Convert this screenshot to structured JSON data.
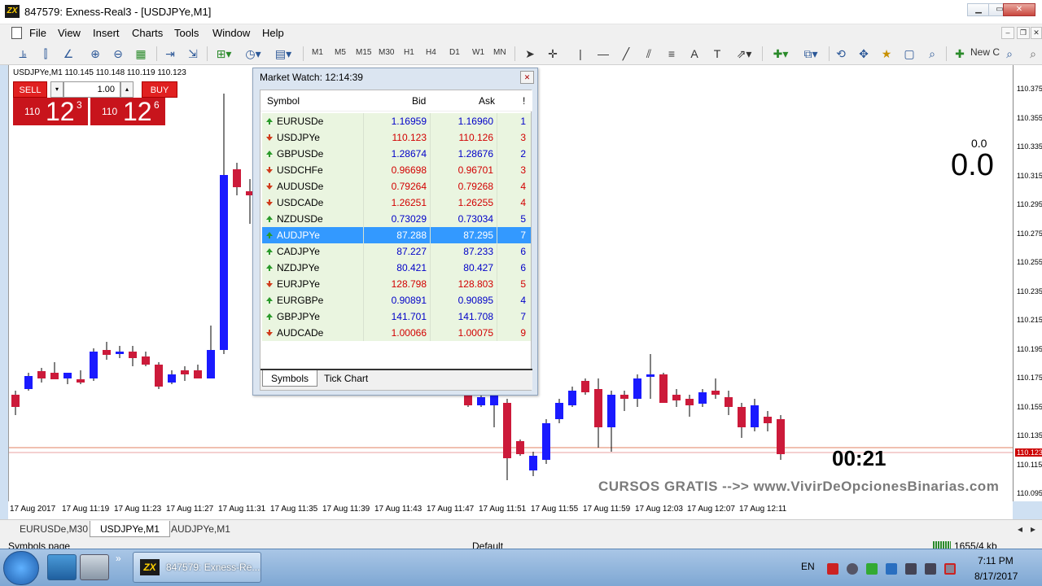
{
  "window": {
    "title": "847579: Exness-Real3 - [USDJPYe,M1]",
    "logo_text": "ZX"
  },
  "menu": [
    "File",
    "View",
    "Insert",
    "Charts",
    "Tools",
    "Window",
    "Help"
  ],
  "toolbar": {
    "timeframes": [
      "M1",
      "M5",
      "M15",
      "M30",
      "H1",
      "H4",
      "D1",
      "W1",
      "MN"
    ],
    "new_order_label": "New C"
  },
  "chart": {
    "symbol_info": "USDJPYe,M1  110.145 110.148 110.119 110.123",
    "price_labels": [
      "110.375",
      "110.355",
      "110.335",
      "110.315",
      "110.295",
      "110.275",
      "110.255",
      "110.235",
      "110.215",
      "110.195",
      "110.175",
      "110.155",
      "110.135",
      "110.123",
      "110.115",
      "110.095"
    ],
    "time_labels": [
      "17 Aug 2017",
      "17 Aug 11:19",
      "17 Aug 11:23",
      "17 Aug 11:27",
      "17 Aug 11:31",
      "17 Aug 11:35",
      "17 Aug 11:39",
      "17 Aug 11:43",
      "17 Aug 11:47",
      "17 Aug 11:51",
      "17 Aug 11:55",
      "17 Aug 11:59",
      "17 Aug 12:03",
      "17 Aug 12:07",
      "17 Aug 12:11"
    ],
    "zero_small": "0.0",
    "zero_big": "0.0",
    "timer": "00:21",
    "watermark": "CURSOS GRATIS -->> www.VivirDeOpcionesBinarias.com"
  },
  "trade_panel": {
    "sell_label": "SELL",
    "buy_label": "BUY",
    "lot": "1.00",
    "sell_quote": {
      "big": "110",
      "pips": "12",
      "sup": "3"
    },
    "buy_quote": {
      "big": "110",
      "pips": "12",
      "sup": "6"
    }
  },
  "market_watch": {
    "title": "Market Watch: 12:14:39",
    "headers": {
      "symbol": "Symbol",
      "bid": "Bid",
      "ask": "Ask",
      "spread": "!"
    },
    "rows": [
      {
        "symbol": "EURUSDe",
        "bid": "1.16959",
        "ask": "1.16960",
        "spread": "1",
        "dir": "up"
      },
      {
        "symbol": "USDJPYe",
        "bid": "110.123",
        "ask": "110.126",
        "spread": "3",
        "dir": "down"
      },
      {
        "symbol": "GBPUSDe",
        "bid": "1.28674",
        "ask": "1.28676",
        "spread": "2",
        "dir": "up"
      },
      {
        "symbol": "USDCHFe",
        "bid": "0.96698",
        "ask": "0.96701",
        "spread": "3",
        "dir": "down"
      },
      {
        "symbol": "AUDUSDe",
        "bid": "0.79264",
        "ask": "0.79268",
        "spread": "4",
        "dir": "down"
      },
      {
        "symbol": "USDCADe",
        "bid": "1.26251",
        "ask": "1.26255",
        "spread": "4",
        "dir": "down"
      },
      {
        "symbol": "NZDUSDe",
        "bid": "0.73029",
        "ask": "0.73034",
        "spread": "5",
        "dir": "up"
      },
      {
        "symbol": "AUDJPYe",
        "bid": "87.288",
        "ask": "87.295",
        "spread": "7",
        "dir": "up"
      },
      {
        "symbol": "CADJPYe",
        "bid": "87.227",
        "ask": "87.233",
        "spread": "6",
        "dir": "up"
      },
      {
        "symbol": "NZDJPYe",
        "bid": "80.421",
        "ask": "80.427",
        "spread": "6",
        "dir": "up"
      },
      {
        "symbol": "EURJPYe",
        "bid": "128.798",
        "ask": "128.803",
        "spread": "5",
        "dir": "down"
      },
      {
        "symbol": "EURGBPe",
        "bid": "0.90891",
        "ask": "0.90895",
        "spread": "4",
        "dir": "up"
      },
      {
        "symbol": "GBPJPYe",
        "bid": "141.701",
        "ask": "141.708",
        "spread": "7",
        "dir": "up"
      },
      {
        "symbol": "AUDCADe",
        "bid": "1.00066",
        "ask": "1.00075",
        "spread": "9",
        "dir": "down"
      }
    ],
    "tabs": [
      "Symbols",
      "Tick Chart"
    ]
  },
  "chart_tabs": [
    "EURUSDe,M30",
    "USDJPYe,M1",
    "AUDJPYe,M1"
  ],
  "status_bar": {
    "left": "Symbols page",
    "profile": "Default",
    "traffic": "1655/4 kb"
  },
  "taskbar": {
    "task_label": "847579: Exness-Re...",
    "lang": "EN",
    "time": "7:11 PM",
    "date": "8/17/2017"
  }
}
